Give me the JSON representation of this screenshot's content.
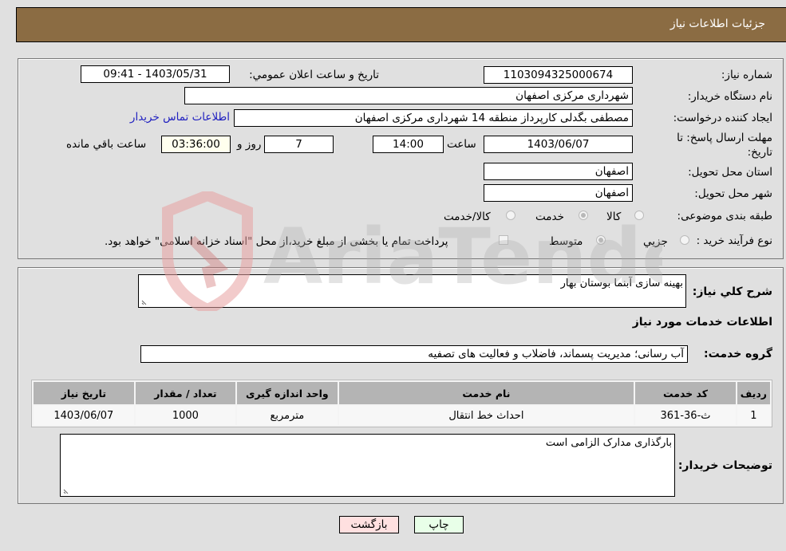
{
  "header": {
    "title": "جزئیات اطلاعات نیاز"
  },
  "form": {
    "need_number": {
      "label": "شماره نیاز:",
      "value": "1103094325000674"
    },
    "announce_datetime": {
      "label": "تاریخ و ساعت اعلان عمومي:",
      "value": "1403/05/31 - 09:41"
    },
    "buyer_org": {
      "label": "نام دستگاه خریدار:",
      "value": "شهرداری مرکزی اصفهان"
    },
    "requester": {
      "label": "ایجاد کننده درخواست:",
      "value": "مصطفی بگدلی کارپرداز منطقه 14 شهرداری مرکزی اصفهان"
    },
    "buyer_contact_link": "اطلاعات تماس خریدار",
    "deadline": {
      "label_line1": "مهلت ارسال پاسخ: تا",
      "label_line2": "تاریخ:",
      "date": "1403/06/07",
      "time_label": "ساعت",
      "time": "14:00",
      "days": "7",
      "days_label": "روز و",
      "remaining": "03:36:00",
      "remaining_label": "ساعت باقي مانده"
    },
    "delivery_province": {
      "label": "استان محل تحویل:",
      "value": "اصفهان"
    },
    "delivery_city": {
      "label": "شهر محل تحویل:",
      "value": "اصفهان"
    },
    "category": {
      "label": "طبقه بندی موضوعی:",
      "options": [
        "کالا",
        "خدمت",
        "کالا/خدمت"
      ],
      "selected": "خدمت"
    },
    "purchase_type": {
      "label": "نوع فرآیند خرید :",
      "options": [
        "جزیي",
        "متوسط"
      ],
      "selected": "متوسط",
      "treasury_note": "پرداخت تمام یا بخشی از مبلغ خرید،از محل \"اسناد خزانه اسلامی\" خواهد بود."
    }
  },
  "description": {
    "label": "شرح كلي نياز:",
    "value": "بهینه سازی آبنما بوستان بهار"
  },
  "services": {
    "section_title": "اطلاعات خدمات مورد نیاز",
    "group_label": "گروه خدمت:",
    "group_value": "آب رسانی؛ مدیریت پسماند، فاضلاب و فعالیت های تصفیه",
    "table": {
      "headers": [
        "ردیف",
        "کد خدمت",
        "نام خدمت",
        "واحد اندازه گیری",
        "تعداد / مقدار",
        "تاریخ نیاز"
      ],
      "rows": [
        [
          "1",
          "ث-36-361",
          "احداث خط انتقال",
          "مترمربع",
          "1000",
          "1403/06/07"
        ]
      ]
    }
  },
  "buyer_notes": {
    "label": "توضیحات خریدار:",
    "value": "بارگذاری مدارک الزامی است"
  },
  "buttons": {
    "print": "چاپ",
    "back": "بازگشت"
  },
  "watermark": {
    "text": "AriaTender.neT"
  }
}
